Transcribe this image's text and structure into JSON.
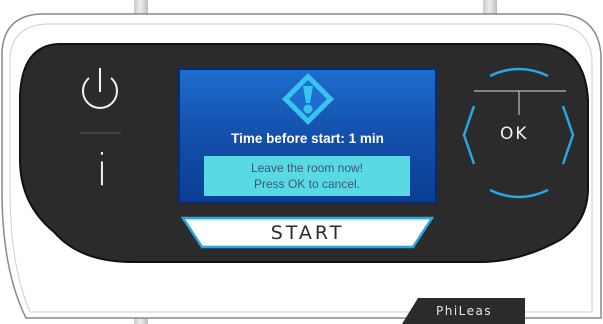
{
  "brand": {
    "logo_text": "PhiLeas"
  },
  "left_panel": {
    "power_icon": "power-icon",
    "info_label": "i"
  },
  "screen": {
    "warning_icon": "warning-diamond-icon",
    "status_text": "Time before start: 1 min",
    "message_line1": "Leave the room now!",
    "message_line2": "Press OK to cancel."
  },
  "start_button": {
    "label": "START"
  },
  "nav": {
    "ok_label": "OK",
    "up_icon": "arc-up-icon",
    "down_icon": "arc-down-icon",
    "left_icon": "arc-left-icon",
    "right_icon": "arc-right-icon"
  },
  "colors": {
    "panel_bg": "#2b2b2b",
    "accent_cyan": "#27a6e6",
    "screen_blue": "#1452ae",
    "message_bg": "#59d9e3",
    "warning_cyan": "#38c4f0"
  }
}
